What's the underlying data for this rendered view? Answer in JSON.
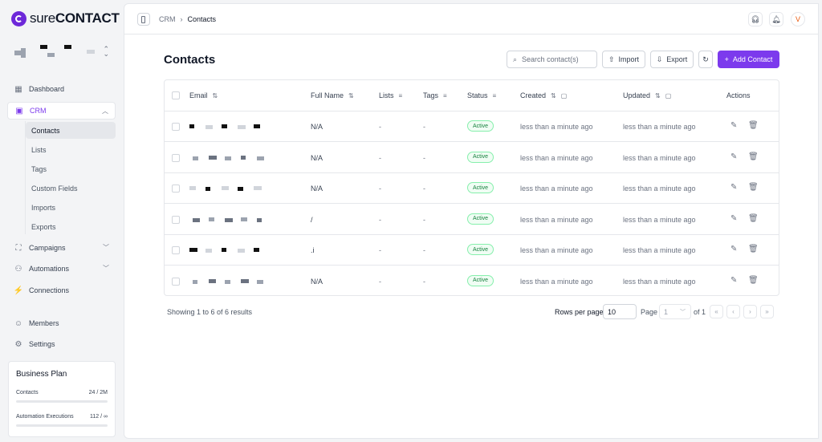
{
  "brand": {
    "name_light": "sure",
    "name_bold": "CONTACT"
  },
  "sidebar": {
    "nav": [
      {
        "label": "Dashboard",
        "icon": "dashboard-icon"
      },
      {
        "label": "CRM",
        "icon": "crm-icon"
      },
      {
        "label": "Campaigns",
        "icon": "campaigns-icon"
      },
      {
        "label": "Automations",
        "icon": "automations-icon"
      },
      {
        "label": "Connections",
        "icon": "connections-icon"
      },
      {
        "label": "Members",
        "icon": "members-icon"
      },
      {
        "label": "Settings",
        "icon": "settings-icon"
      }
    ],
    "crm_sub": [
      "Contacts",
      "Lists",
      "Tags",
      "Custom Fields",
      "Imports",
      "Exports"
    ],
    "plan": {
      "title": "Business Plan",
      "contacts_label": "Contacts",
      "contacts_value": "24 / 2M",
      "contacts_usage": 0.0,
      "executions_label": "Automation Executions",
      "executions_value": "112 / ∞",
      "executions_usage": 0.0
    }
  },
  "topbar": {
    "crumb_root": "CRM",
    "crumb_sep": "›",
    "crumb_current": "Contacts",
    "avatar_initial": "V"
  },
  "page": {
    "title": "Contacts",
    "search_placeholder": "Search contact(s)",
    "import_label": "Import",
    "export_label": "Export",
    "add_label": "Add Contact"
  },
  "table": {
    "columns": [
      "Email",
      "Full Name",
      "Lists",
      "Tags",
      "Status",
      "Created",
      "Updated",
      "Actions"
    ],
    "rows": [
      {
        "full_name": "N/A",
        "lists": "-",
        "tags": "-",
        "status": "Active",
        "created": "less than a minute ago",
        "updated": "less than a minute ago"
      },
      {
        "full_name": "N/A",
        "lists": "-",
        "tags": "-",
        "status": "Active",
        "created": "less than a minute ago",
        "updated": "less than a minute ago"
      },
      {
        "full_name": "N/A",
        "lists": "-",
        "tags": "-",
        "status": "Active",
        "created": "less than a minute ago",
        "updated": "less than a minute ago"
      },
      {
        "full_name": "/",
        "lists": "-",
        "tags": "-",
        "status": "Active",
        "created": "less than a minute ago",
        "updated": "less than a minute ago"
      },
      {
        "full_name": ".i",
        "lists": "-",
        "tags": "-",
        "status": "Active",
        "created": "less than a minute ago",
        "updated": "less than a minute ago"
      },
      {
        "full_name": "N/A",
        "lists": "-",
        "tags": "-",
        "status": "Active",
        "created": "less than a minute ago",
        "updated": "less than a minute ago"
      }
    ]
  },
  "footer": {
    "showing": "Showing 1 to 6 of 6 results",
    "rows_per_page_label": "Rows per page",
    "rows_per_page_value": "10",
    "page_label": "Page",
    "page_value": "1",
    "of_label": "of 1"
  }
}
